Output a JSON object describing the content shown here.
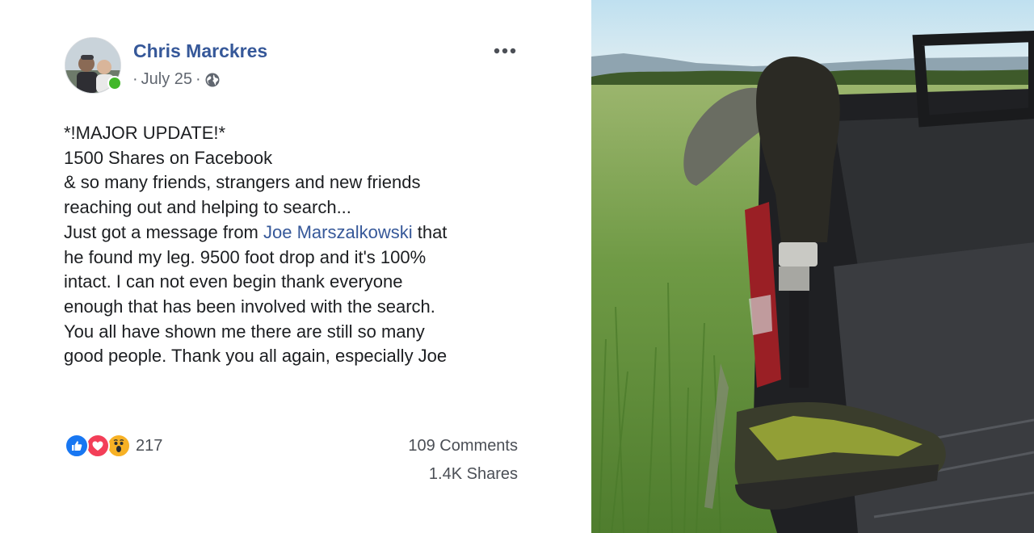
{
  "post": {
    "author": "Chris Marckres",
    "date": "July 25",
    "separator": "·",
    "privacy_icon": "globe-icon",
    "more_icon": "ellipsis-icon",
    "text_lines": [
      "*!MAJOR UPDATE!*",
      "1500 Shares on Facebook",
      "& so many friends, strangers and new friends",
      "reaching out and helping to search...",
      "Just got a message from ",
      "he found my leg. 9500 foot drop and it's 100%",
      "intact. I can not even begin thank everyone",
      "enough that has been involved with the search.",
      "You all have shown me there are still so many",
      "good people. Thank you all again, especially Joe"
    ],
    "mention": "Joe Marszalkowski",
    "mention_suffix": " that"
  },
  "reactions": {
    "icons": [
      "like-icon",
      "love-icon",
      "wow-icon"
    ],
    "count": "217"
  },
  "stats": {
    "comments": "109 Comments",
    "shares": "1.4K Shares"
  },
  "colors": {
    "link": "#365899",
    "online": "#42b72a",
    "like": "#1877f2",
    "love": "#f33e58",
    "wow": "#f7b125"
  }
}
